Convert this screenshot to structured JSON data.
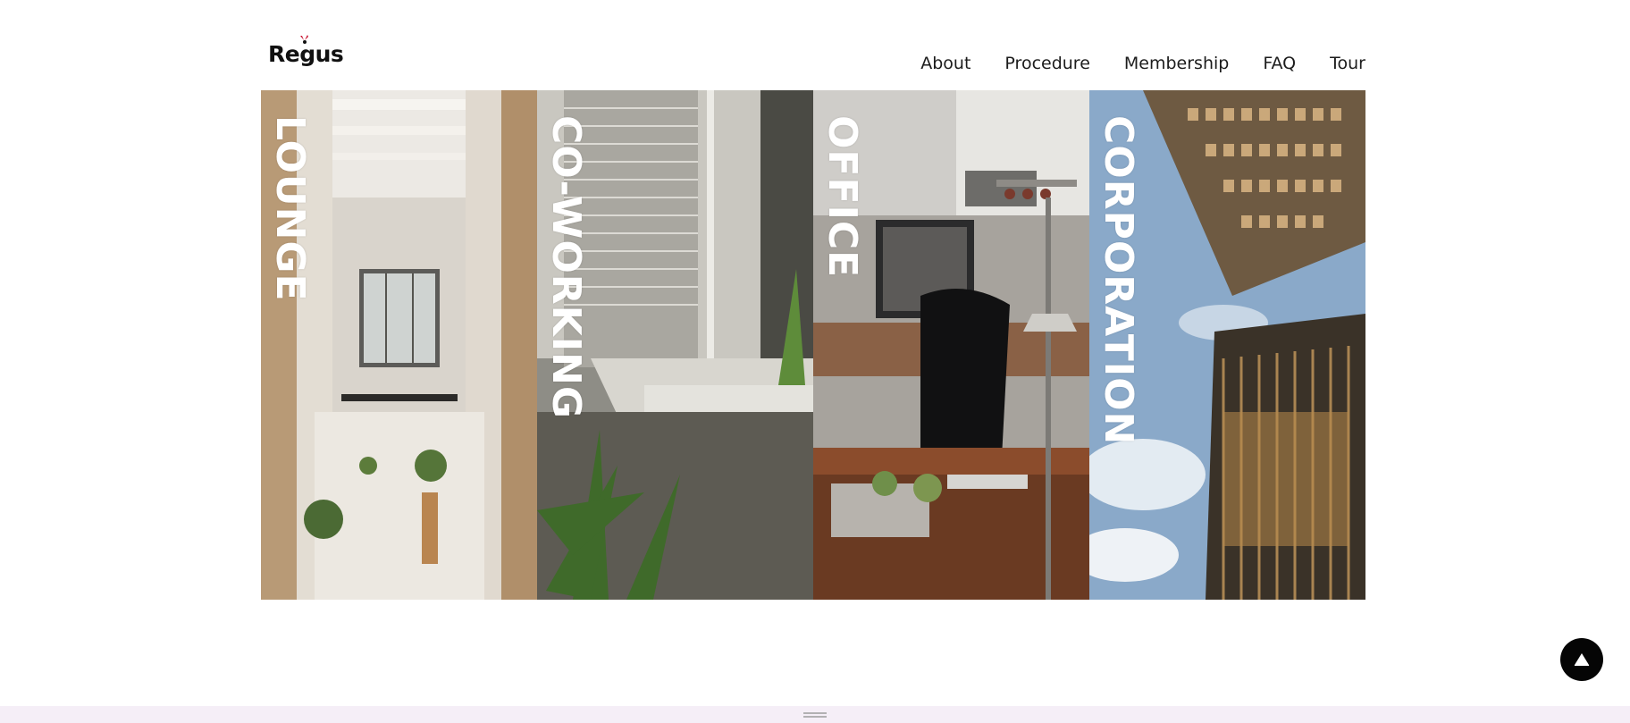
{
  "brand": {
    "name": "Regus"
  },
  "nav": {
    "items": [
      "About",
      "Procedure",
      "Membership",
      "FAQ",
      "Tour"
    ]
  },
  "panels": [
    {
      "label": "LOUNGE",
      "icon": "lounge-photo"
    },
    {
      "label": "CO-WORKING",
      "icon": "coworking-photo"
    },
    {
      "label": "OFFICE",
      "icon": "office-photo"
    },
    {
      "label": "CORPORATION",
      "icon": "corporation-photo"
    }
  ],
  "back_to_top": {
    "icon": "triangle-up-icon"
  },
  "bottom_bar": {
    "icon": "drag-handle-icon"
  },
  "colors": {
    "logo_accent": "#c8102e",
    "text": "#1c1c1c",
    "label": "#ffffff",
    "button": "#050505",
    "bottom_bar": "#f5eef7"
  }
}
